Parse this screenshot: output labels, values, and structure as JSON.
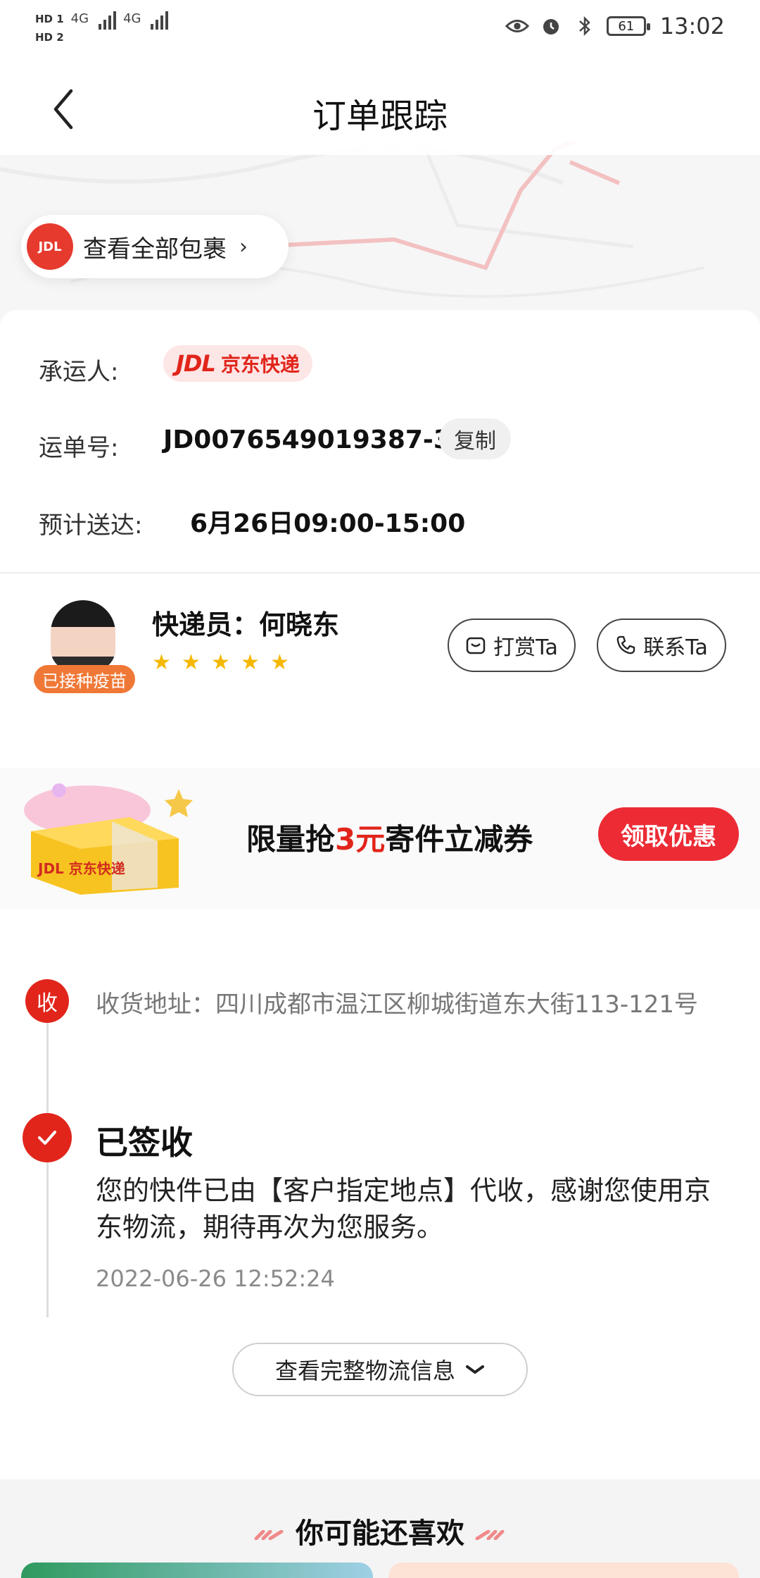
{
  "status_bar": {
    "sim1": "HD 1",
    "sim2": "HD 2",
    "net1": "4G",
    "net2": "4G",
    "battery": "61",
    "time": "13:02"
  },
  "header": {
    "title": "订单跟踪"
  },
  "map": {
    "pkg_logo": "JDL",
    "view_all_packages": "查看全部包裹"
  },
  "shipment": {
    "carrier_label": "承运人:",
    "carrier_logo": "JDL",
    "carrier_name": "京东快递",
    "tracking_label": "运单号:",
    "tracking_number": "JD0076549019387-3",
    "copy_label": "复制",
    "eta_label": "预计送达:",
    "eta_value": "6月26日09:00-15:00"
  },
  "courier": {
    "name": "快递员：何晓东",
    "vaccine_badge": "已接种疫苗",
    "rating": 5,
    "tip_label": "打赏Ta",
    "contact_label": "联系Ta"
  },
  "promo": {
    "text_before": "限量抢",
    "text_highlight": "3元",
    "text_after": "寄件立减券",
    "button_label": "领取优惠",
    "box_brand": "JDL 京东快递"
  },
  "timeline": {
    "receive_badge": "收",
    "address": "收货地址：四川成都市温江区柳城街道东大街113-121号",
    "signed_title": "已签收",
    "signed_desc": "您的快件已由【客户指定地点】代收，感谢您使用京东物流，期待再次为您服务。",
    "signed_time": "2022-06-26 12:52:24",
    "more_label": "查看完整物流信息"
  },
  "recommend": {
    "title": "你可能还喜欢"
  },
  "colors": {
    "brand_red": "#e1251b",
    "vaccine_orange": "#f07836",
    "star_yellow": "#f5b800"
  }
}
